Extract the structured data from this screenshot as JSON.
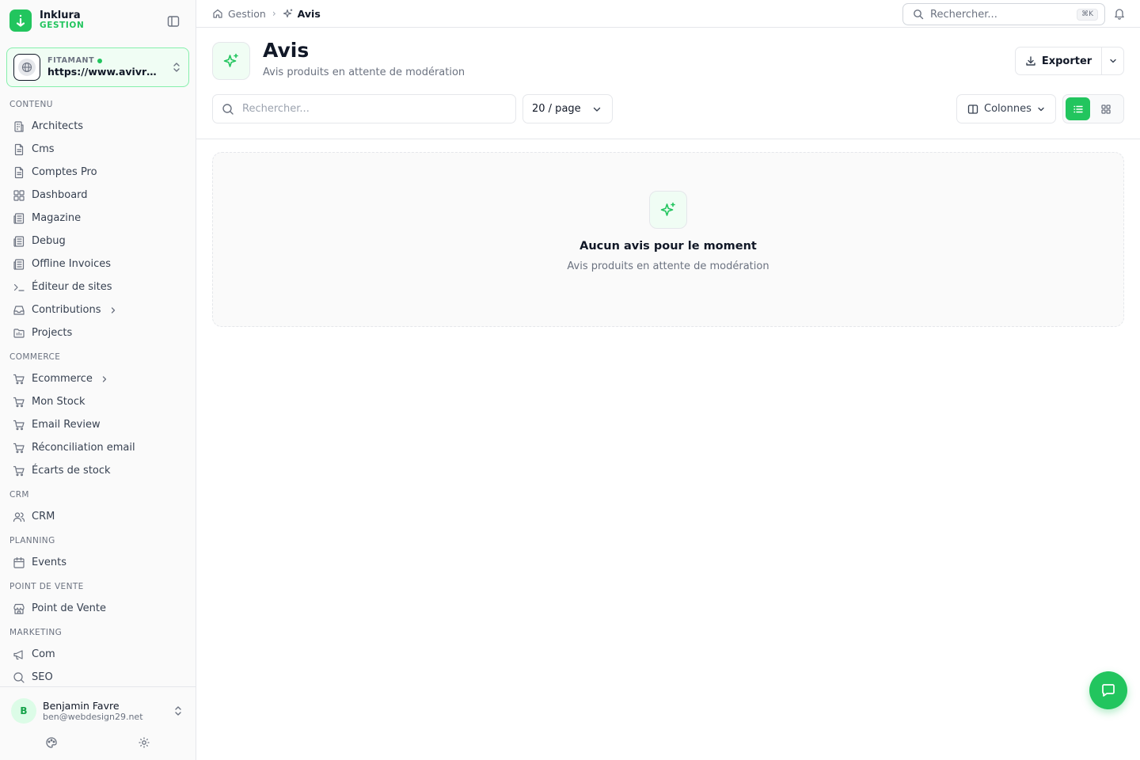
{
  "brand": {
    "name": "Inklura",
    "sub": "GESTION"
  },
  "site": {
    "label": "FITAMANT",
    "url": "https://www.avivre.fr"
  },
  "nav": {
    "sections": [
      {
        "title": "CONTENU",
        "items": [
          {
            "label": "Architects",
            "icon": "building-icon"
          },
          {
            "label": "Cms",
            "icon": "file-text-icon"
          },
          {
            "label": "Comptes Pro",
            "icon": "file-text-icon"
          },
          {
            "label": "Dashboard",
            "icon": "layout-grid-icon"
          },
          {
            "label": "Magazine",
            "icon": "newspaper-icon"
          },
          {
            "label": "Debug",
            "icon": "newspaper-icon"
          },
          {
            "label": "Offline Invoices",
            "icon": "newspaper-icon"
          },
          {
            "label": "Éditeur de sites",
            "icon": "terminal-icon"
          },
          {
            "label": "Contributions",
            "icon": "inbox-icon",
            "expandable": true
          },
          {
            "label": "Projects",
            "icon": "folder-icon"
          }
        ]
      },
      {
        "title": "COMMERCE",
        "items": [
          {
            "label": "Ecommerce",
            "icon": "cart-icon",
            "expandable": true
          },
          {
            "label": "Mon Stock",
            "icon": "cart-icon"
          },
          {
            "label": "Email Review",
            "icon": "cart-icon"
          },
          {
            "label": "Réconciliation email",
            "icon": "cart-icon"
          },
          {
            "label": "Écarts de stock",
            "icon": "cart-icon"
          }
        ]
      },
      {
        "title": "CRM",
        "items": [
          {
            "label": "CRM",
            "icon": "users-icon"
          }
        ]
      },
      {
        "title": "PLANNING",
        "items": [
          {
            "label": "Events",
            "icon": "calendar-icon"
          }
        ]
      },
      {
        "title": "POINT DE VENTE",
        "items": [
          {
            "label": "Point de Vente",
            "icon": "store-icon"
          }
        ]
      },
      {
        "title": "MARKETING",
        "items": [
          {
            "label": "Com",
            "icon": "megaphone-icon"
          },
          {
            "label": "SEO",
            "icon": "search-icon"
          }
        ]
      }
    ]
  },
  "user": {
    "initial": "B",
    "name": "Benjamin Favre",
    "email": "ben@webdesign29.net"
  },
  "breadcrumb": {
    "root": "Gestion",
    "current": "Avis"
  },
  "top_search": {
    "placeholder": "Rechercher...",
    "shortcut": "⌘K"
  },
  "page": {
    "title": "Avis",
    "subtitle": "Avis produits en attente de modération",
    "export_label": "Exporter",
    "search_placeholder": "Rechercher...",
    "per_page": "20 / page",
    "columns_label": "Colonnes",
    "view_mode": "list"
  },
  "empty": {
    "title": "Aucun avis pour le moment",
    "subtitle": "Avis produits en attente de modération"
  },
  "colors": {
    "accent": "#22c55e",
    "accent_light": "#f0fdf4",
    "text": "#111827",
    "muted": "#6b7280"
  }
}
